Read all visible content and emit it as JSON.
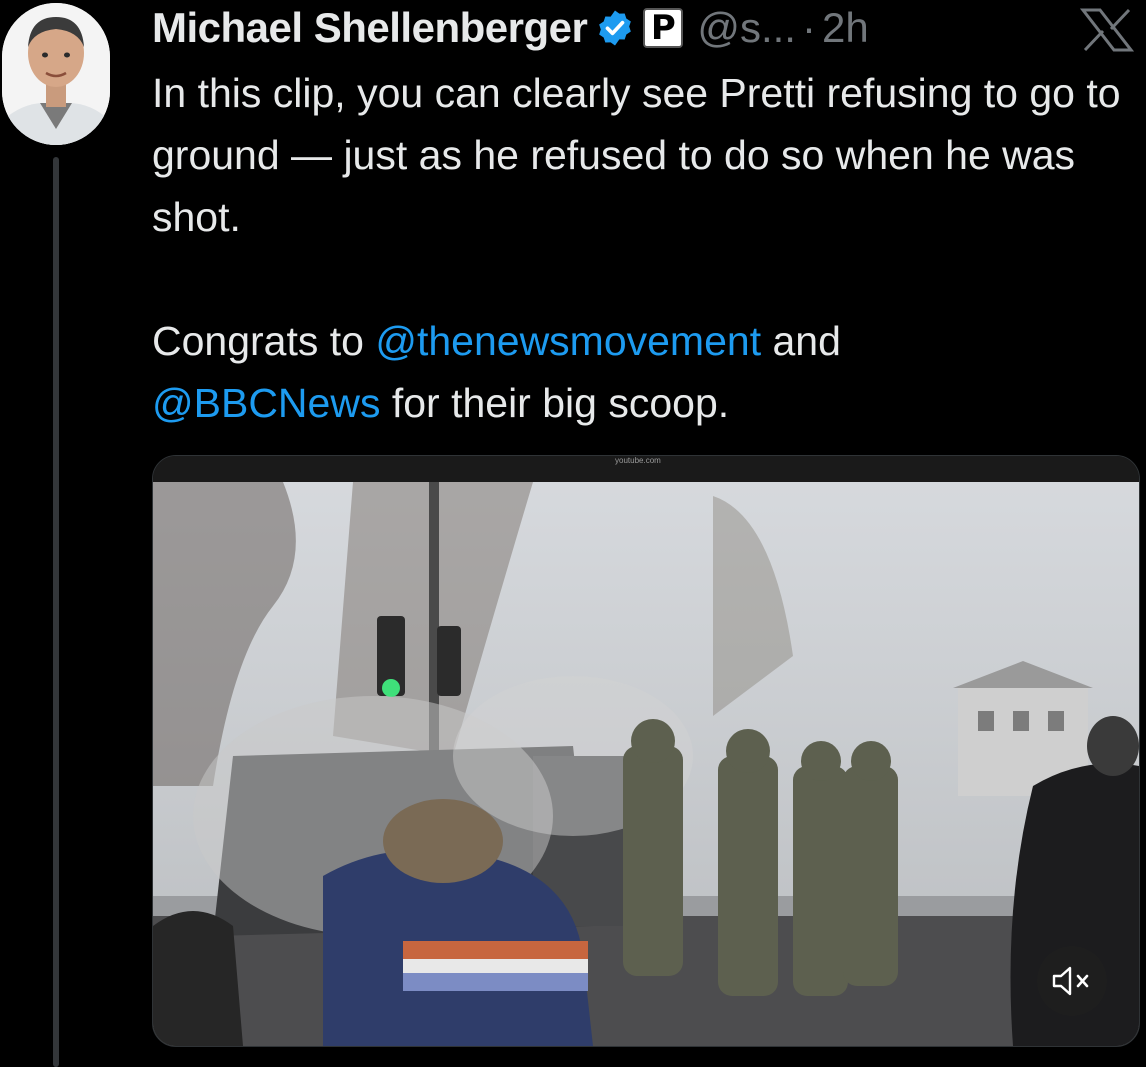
{
  "tweet": {
    "author": {
      "display_name": "Michael Shellenberger",
      "handle": "@s...",
      "affiliate_badge": "P"
    },
    "separator": "·",
    "time": "2h",
    "text": {
      "line1": "In this clip, you can clearly see Pretti refusing to go to ground — just as he refused to do so when he was shot.",
      "line2_prefix": "Congrats to ",
      "mention1": "@thenewsmovement",
      "line2_mid": " and",
      "mention2": "@BBCNews",
      "line2_suffix": " for their big scoop."
    },
    "media": {
      "source": "youtube.com",
      "type": "video",
      "muted": true
    }
  },
  "icons": {
    "verified": "verified-badge-icon",
    "logo": "x-logo-icon",
    "mute": "speaker-muted-icon"
  },
  "colors": {
    "background": "#000000",
    "text": "#e7e9ea",
    "muted_text": "#71767b",
    "link": "#1d9bf0",
    "verified": "#1d9bf0"
  }
}
